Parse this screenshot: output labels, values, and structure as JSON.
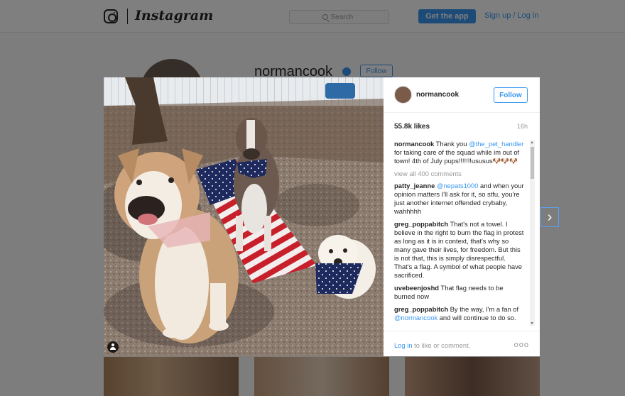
{
  "header": {
    "brand": "Instagram",
    "search_placeholder": "Search",
    "get_app_label": "Get the app",
    "signup_label": "Sign up",
    "separator": "/",
    "login_label": "Log in"
  },
  "profile": {
    "username": "normancook",
    "follow_label": "Follow"
  },
  "post": {
    "username": "normancook",
    "follow_label": "Follow",
    "likes": "55.8k likes",
    "time": "16h",
    "caption_user": "normancook",
    "caption_pre": "Thank you ",
    "caption_mention": "@the_pet_handler",
    "caption_post": " for taking care of the squad while im out of town! 4th of July pups!!!!!!!ususus🐶🐶🐶",
    "view_all": "view all 400 comments",
    "comments": [
      {
        "user": "patty_jeanne",
        "mention": "@nepats1000",
        "text": " and when your opinion matters I'll ask for it, so stfu, you're just another internet offended crybaby, wahhhhh"
      },
      {
        "user": "greg_poppabitch",
        "mention": "",
        "text": " That's not a towel. I believe in the right to burn the flag in protest as long as it is in context, that's why so many gave their lives, for freedom. But this is not that, this is simply disrespectful. That's a flag. A symbol of what people have sacrificed."
      },
      {
        "user": "uvebeenjoshd",
        "mention": "",
        "text": " That flag needs to be burned now"
      },
      {
        "user": "greg_poppabitch",
        "mention": "@normancook",
        "pre": " By the way, I'm a fan of ",
        "text": " and will continue to do so."
      }
    ],
    "login_link": "Log in",
    "login_rest": " to like or comment.",
    "more": "ooo"
  },
  "colors": {
    "accent": "#3897f0",
    "overlay": "rgba(0,0,0,0.5)"
  }
}
